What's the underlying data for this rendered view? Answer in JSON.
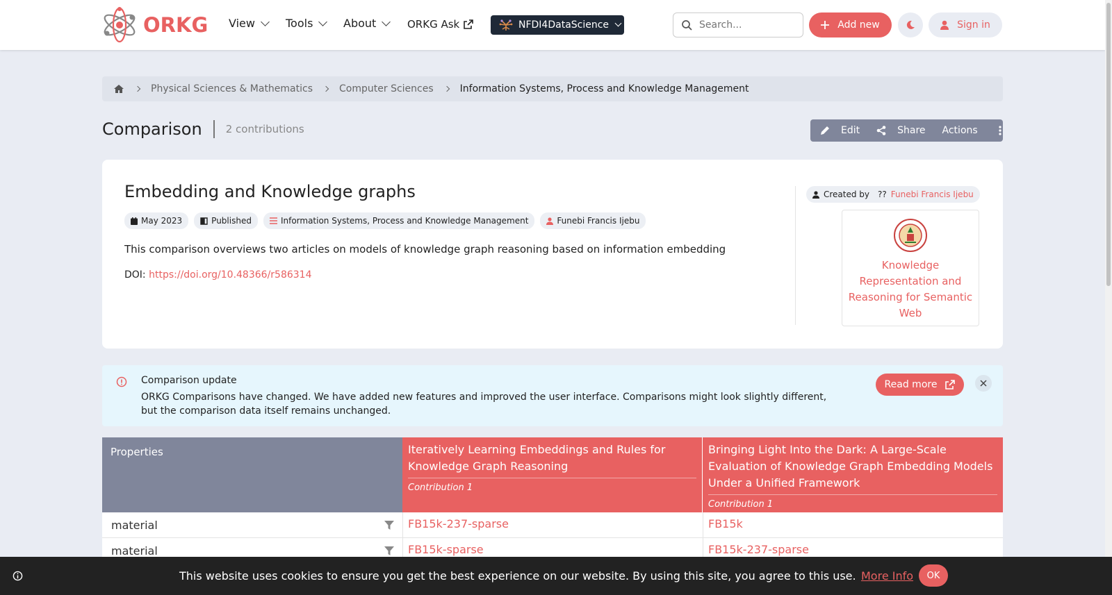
{
  "brand": {
    "name": "ORKG",
    "accent": "#e86161",
    "dark": "#222222",
    "nav_muted": "#80869b"
  },
  "nav": {
    "items": [
      {
        "label": "View"
      },
      {
        "label": "Tools"
      },
      {
        "label": "About"
      },
      {
        "label": "ORKG Ask"
      }
    ],
    "observatory": "NFDI4DataScience",
    "search_placeholder": "Search...",
    "add_new": "Add new",
    "sign_in": "Sign in"
  },
  "breadcrumb": [
    "Physical Sciences & Mathematics",
    "Computer Sciences",
    "Information Systems, Process and Knowledge Management"
  ],
  "header": {
    "title": "Comparison",
    "contributions": "2 contributions",
    "edit": "Edit",
    "share": "Share",
    "actions": "Actions"
  },
  "paper": {
    "title": "Embedding and Knowledge graphs",
    "date": "May 2023",
    "status": "Published",
    "field": "Information Systems, Process and Knowledge Management",
    "author": "Funebi Francis Ijebu",
    "description": "This comparison overviews two articles on models of knowledge graph reasoning based on information embedding",
    "doi_label": "DOI:",
    "doi": "https://doi.org/10.48366/r586314",
    "created_by_label": "Created by",
    "created_by_unknown": "??",
    "created_by": "Funebi Francis Ijebu",
    "org_name": "Knowledge Representation and Reasoning for Semantic Web"
  },
  "alert": {
    "title": "Comparison update",
    "text": "ORKG Comparisons have changed. We have added new features and improved the user interface. Comparisons might look slightly different, but the comparison data itself remains unchanged.",
    "read_more": "Read more"
  },
  "table": {
    "properties_label": "Properties",
    "columns": [
      {
        "title": "Iteratively Learning Embeddings and Rules for Knowledge Graph Reasoning",
        "sub": "Contribution 1"
      },
      {
        "title": "Bringing Light Into the Dark: A Large-Scale Evaluation of Knowledge Graph Embedding Models Under a Unified Framework",
        "sub": "Contribution 1"
      }
    ],
    "rows": [
      {
        "property": "material",
        "values": [
          "FB15k-237-sparse",
          "FB15k"
        ]
      },
      {
        "property": "material",
        "values": [
          "FB15k-sparse",
          "FB15k-237-sparse"
        ]
      }
    ]
  },
  "cookie": {
    "text": "This website uses cookies to ensure you get the best experience on our website. By using this site, you agree to this use.",
    "more": "More Info",
    "ok": "OK"
  }
}
